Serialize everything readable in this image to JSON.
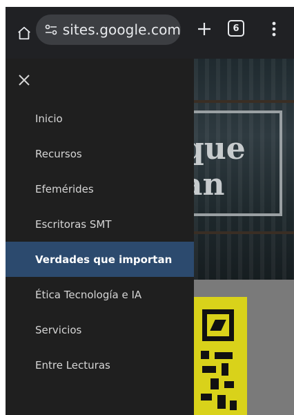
{
  "browser": {
    "url": "sites.google.com",
    "tab_count": "6",
    "icons": [
      "home-icon",
      "site-settings-icon",
      "plus-icon",
      "tabs-icon",
      "more-vert-icon"
    ]
  },
  "drawer": {
    "close_icon": "close-icon",
    "items": [
      {
        "label": "Inicio"
      },
      {
        "label": "Recursos"
      },
      {
        "label": "Efemérides"
      },
      {
        "label": "Escritoras SMT"
      },
      {
        "label": "Verdades que importan",
        "active": true
      },
      {
        "label": "Ética Tecnología e IA"
      },
      {
        "label": "Servicios"
      },
      {
        "label": "Entre Lecturas"
      }
    ]
  },
  "page": {
    "hero_title_visible": "que\nan"
  },
  "colors": {
    "browser_bar": "#202124",
    "drawer_bg": "#1f1f1f",
    "active_item": "#2c4a6e",
    "qr_yellow": "#d9d21a"
  }
}
